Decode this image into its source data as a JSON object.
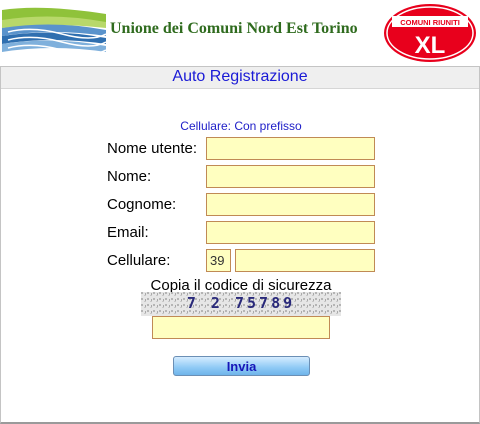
{
  "header": {
    "org_name": "Unione dei Comuni Nord Est Torino",
    "logo_icon": "landscape-waves-logo",
    "xl_logo": {
      "top_text": "COMUNI RIUNITI",
      "main_text": "XL",
      "icon": "comuni-riuniti-xl-logo",
      "color": "#e8001c"
    }
  },
  "form": {
    "title": "Auto Registrazione",
    "hint": "Cellulare: Con prefisso",
    "fields": {
      "username_label": "Nome utente:",
      "username_value": "",
      "firstname_label": "Nome:",
      "firstname_value": "",
      "lastname_label": "Cognome:",
      "lastname_value": "",
      "email_label": "Email:",
      "email_value": "",
      "phone_label": "Cellulare:",
      "phone_prefix": "39",
      "phone_value": ""
    },
    "captcha": {
      "label": "Copia il codice di sicurezza",
      "code": "7 2 75789",
      "input_value": ""
    },
    "submit_label": "Invia"
  },
  "colors": {
    "field_bg": "#ffffc0",
    "field_border": "#c08a55",
    "title": "#1a1ad6",
    "button": "#8ec9f5"
  }
}
